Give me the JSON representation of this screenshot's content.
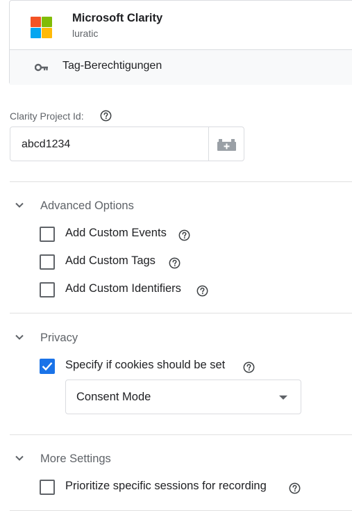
{
  "template": {
    "name": "Microsoft Clarity",
    "subtitle": "luratic",
    "permissions_label": "Tag-Berechtigungen",
    "logo_colors": [
      "#f35325",
      "#81bc06",
      "#05a6f0",
      "#ffba08"
    ]
  },
  "project_id": {
    "label": "Clarity Project Id:",
    "value": "abcd1234",
    "help_icon": "question-circle-icon",
    "variable_icon": "variable-brick-icon"
  },
  "advanced_options": {
    "title": "Advanced Options",
    "expanded": true,
    "items": [
      {
        "label": "Add Custom Events",
        "checked": false
      },
      {
        "label": "Add Custom Tags",
        "checked": false
      },
      {
        "label": "Add Custom Identifiers",
        "checked": false
      }
    ]
  },
  "privacy": {
    "title": "Privacy",
    "expanded": true,
    "cookies_label": "Specify if cookies should be set",
    "cookies_checked": true,
    "mode_value": "Consent Mode"
  },
  "more_settings": {
    "title": "More Settings",
    "expanded": true,
    "prioritize_label": "Prioritize specific sessions for recording",
    "prioritize_checked": false
  },
  "colors": {
    "accent": "#1a73e8",
    "border": "#dadce0",
    "muted_text": "#5f6368"
  }
}
